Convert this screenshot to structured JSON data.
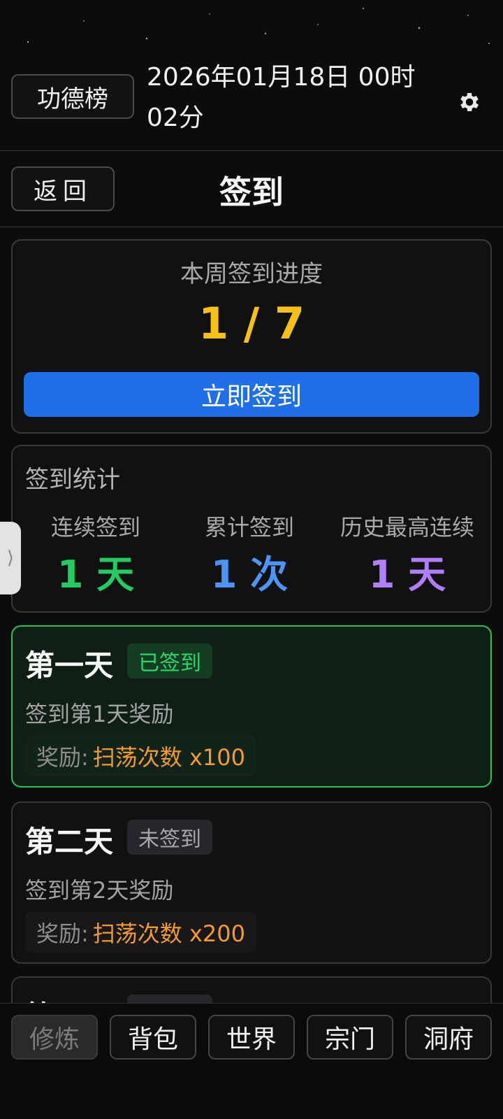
{
  "header": {
    "leaderboard_label": "功德榜",
    "datetime": "2026年01月18日 00时02分",
    "settings_icon": "gear-icon"
  },
  "subheader": {
    "back_label": "返回",
    "title": "签到"
  },
  "progress": {
    "title": "本周签到进度",
    "value": "1 / 7",
    "sign_button": "立即签到"
  },
  "stats": {
    "title": "签到统计",
    "items": [
      {
        "label": "连续签到",
        "value": "1 天",
        "color": "#22cc60"
      },
      {
        "label": "累计签到",
        "value": "1 次",
        "color": "#4c94f5"
      },
      {
        "label": "历史最高连续",
        "value": "1 天",
        "color": "#b07ef7"
      }
    ]
  },
  "side_handle": {
    "glyph": "⟩"
  },
  "days": [
    {
      "title": "第一天",
      "status": "已签到",
      "desc": "签到第1天奖励",
      "reward_label": "奖励:",
      "reward_value": "扫荡次数 x100"
    },
    {
      "title": "第二天",
      "status": "未签到",
      "desc": "签到第2天奖励",
      "reward_label": "奖励:",
      "reward_value": "扫荡次数 x200"
    },
    {
      "title": "第三天",
      "status": "未签到"
    }
  ],
  "nav": [
    {
      "label": "修炼",
      "active": true
    },
    {
      "label": "背包",
      "active": false
    },
    {
      "label": "世界",
      "active": false
    },
    {
      "label": "宗门",
      "active": false
    },
    {
      "label": "洞府",
      "active": false
    }
  ]
}
